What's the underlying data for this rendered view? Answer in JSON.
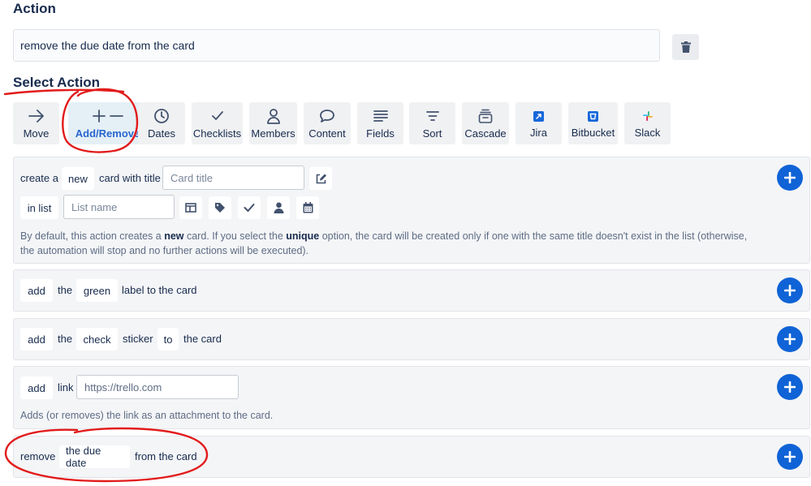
{
  "header": {
    "title": "Action",
    "action_name": "remove the due date from the card"
  },
  "select_action": {
    "title": "Select Action"
  },
  "tabs": [
    {
      "label": "Move",
      "icon": "arrow-right-icon"
    },
    {
      "label": "Add/Remove",
      "icon": "plus-minus-icon",
      "active": true
    },
    {
      "label": "Dates",
      "icon": "clock-icon"
    },
    {
      "label": "Checklists",
      "icon": "checkmark-icon"
    },
    {
      "label": "Members",
      "icon": "person-icon"
    },
    {
      "label": "Content",
      "icon": "speech-bubble-icon"
    },
    {
      "label": "Fields",
      "icon": "lines-icon"
    },
    {
      "label": "Sort",
      "icon": "sort-icon"
    },
    {
      "label": "Cascade",
      "icon": "cascade-icon"
    },
    {
      "label": "Jira",
      "icon": "jira-icon"
    },
    {
      "label": "Bitbucket",
      "icon": "bitbucket-icon"
    },
    {
      "label": "Slack",
      "icon": "slack-icon"
    }
  ],
  "create_card": {
    "prefix": "create a",
    "mode": "new",
    "middle": "card with title",
    "title_placeholder": "Card title",
    "in_list": "in list",
    "list_placeholder": "List name",
    "desc_1": "By default, this action creates a ",
    "desc_bold_1": "new",
    "desc_2": " card. If you select the ",
    "desc_bold_2": "unique",
    "desc_3": " option, the card will be created only if one with the same title doesn't exist in the list (otherwise,",
    "desc_4": "the automation will stop and no further actions will be executed)."
  },
  "label_row": {
    "verb": "add",
    "the": "the",
    "color": "green",
    "suffix": "label to the card"
  },
  "sticker_row": {
    "verb": "add",
    "the": "the",
    "sticker": "check",
    "word": "sticker",
    "to": "to",
    "suffix": "the card"
  },
  "link_row": {
    "verb": "add",
    "word": "link",
    "value": "https://trello.com",
    "desc": "Adds (or removes) the link as an attachment to the card."
  },
  "due_row": {
    "verb": "remove",
    "item": "the due date",
    "suffix": "from the card"
  },
  "colors": {
    "accent": "#2866cf",
    "plus_button": "#0f63d6",
    "annotation": "#e21b1b"
  }
}
